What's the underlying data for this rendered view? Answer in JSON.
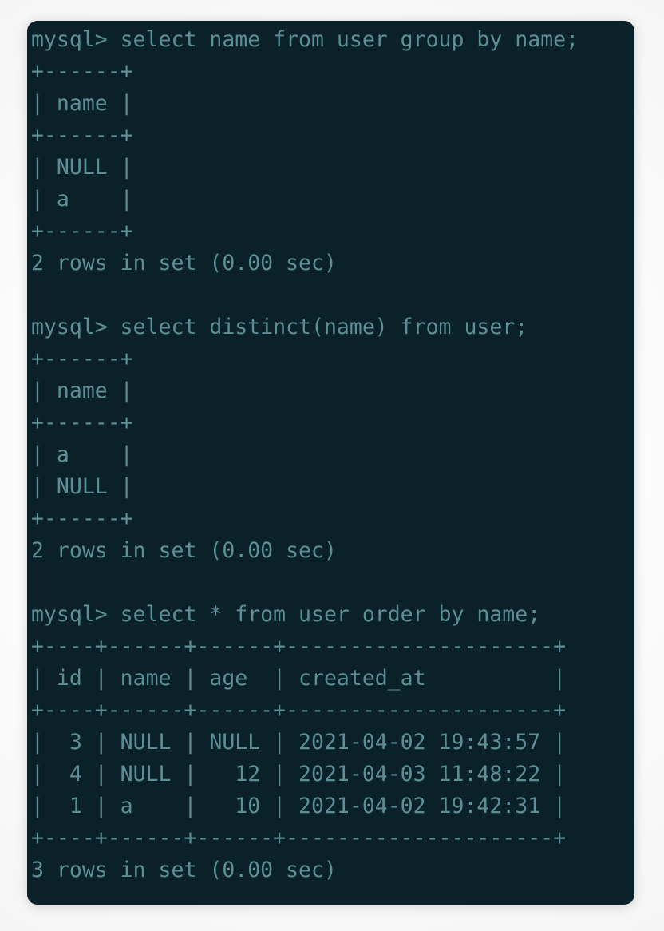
{
  "terminal": {
    "prompt": "mysql> ",
    "background_color": "#0a2129",
    "text_color": "#5d8e96",
    "page_background_color": "#f4f4f4",
    "lines": [
      "mysql> select name from user group by name;",
      "+------+",
      "| name |",
      "+------+",
      "| NULL |",
      "| a    |",
      "+------+",
      "2 rows in set (0.00 sec)",
      "",
      "mysql> select distinct(name) from user;",
      "+------+",
      "| name |",
      "+------+",
      "| a    |",
      "| NULL |",
      "+------+",
      "2 rows in set (0.00 sec)",
      "",
      "mysql> select * from user order by name;",
      "+----+------+------+---------------------+",
      "| id | name | age  | created_at          |",
      "+----+------+------+---------------------+",
      "|  3 | NULL | NULL | 2021-04-02 19:43:57 |",
      "|  4 | NULL |   12 | 2021-04-03 11:48:22 |",
      "|  1 | a    |   10 | 2021-04-02 19:42:31 |",
      "+----+------+------+---------------------+",
      "3 rows in set (0.00 sec)"
    ],
    "commands": [
      {
        "index": 0,
        "sql": "select name from user group by name;",
        "result_columns": [
          "name"
        ],
        "result_rows": [
          [
            "NULL"
          ],
          [
            "a"
          ]
        ],
        "status": "2 rows in set (0.00 sec)"
      },
      {
        "index": 1,
        "sql": "select distinct(name) from user;",
        "result_columns": [
          "name"
        ],
        "result_rows": [
          [
            "a"
          ],
          [
            "NULL"
          ]
        ],
        "status": "2 rows in set (0.00 sec)"
      },
      {
        "index": 2,
        "sql": "select * from user order by name;",
        "result_columns": [
          "id",
          "name",
          "age",
          "created_at"
        ],
        "result_rows": [
          [
            "3",
            "NULL",
            "NULL",
            "2021-04-02 19:43:57"
          ],
          [
            "4",
            "NULL",
            "12",
            "2021-04-03 11:48:22"
          ],
          [
            "1",
            "a",
            "10",
            "2021-04-02 19:42:31"
          ]
        ],
        "status": "3 rows in set (0.00 sec)"
      }
    ]
  }
}
